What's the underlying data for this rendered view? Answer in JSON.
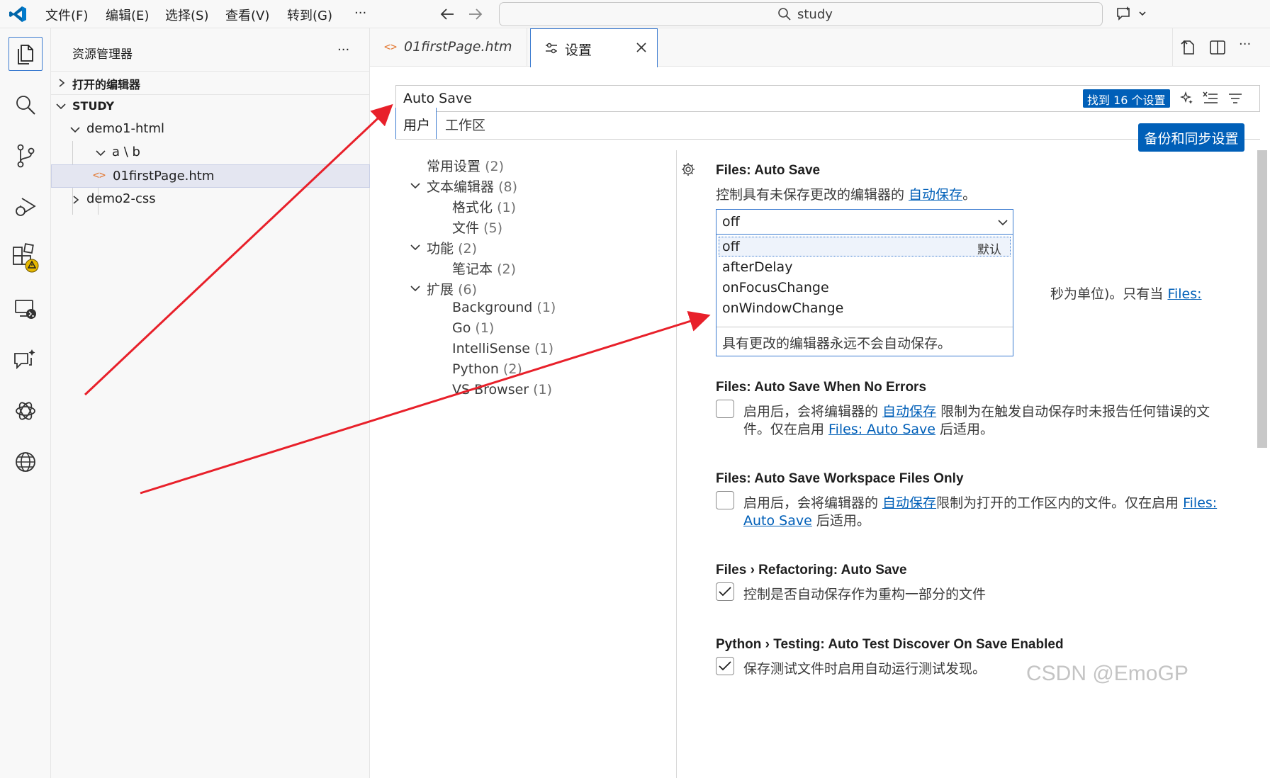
{
  "menu": [
    "文件(F)",
    "编辑(E)",
    "选择(S)",
    "查看(V)",
    "转到(G)",
    "···"
  ],
  "command_center": {
    "text": "study"
  },
  "explorer": {
    "title": "资源管理器",
    "more": "···",
    "open_editors": "打开的编辑器",
    "root": "STUDY",
    "items": [
      "demo1-html",
      "a \\ b",
      "01firstPage.htm",
      "demo2-css"
    ]
  },
  "tabs": [
    {
      "label": "01firstPage.htm"
    },
    {
      "label": "设置"
    }
  ],
  "settings": {
    "search_value": "Auto Save",
    "found_badge": "找到 16 个设置",
    "scope_tabs": [
      "用户",
      "工作区"
    ],
    "sync_button": "备份和同步设置",
    "toc": [
      {
        "label": "常用设置",
        "count": "(2)"
      },
      {
        "label": "文本编辑器",
        "count": "(8)"
      },
      {
        "label": "格式化",
        "count": "(1)"
      },
      {
        "label": "文件",
        "count": "(5)"
      },
      {
        "label": "功能",
        "count": "(2)"
      },
      {
        "label": "笔记本",
        "count": "(2)"
      },
      {
        "label": "扩展",
        "count": "(6)"
      },
      {
        "label": "Background",
        "count": "(1)"
      },
      {
        "label": "Go",
        "count": "(1)"
      },
      {
        "label": "IntelliSense",
        "count": "(1)"
      },
      {
        "label": "Python",
        "count": "(2)"
      },
      {
        "label": "VS Browser",
        "count": "(1)"
      }
    ],
    "autosave": {
      "title": "Files: Auto Save",
      "desc": "控制具有未保存更改的编辑器的 ",
      "desc_link": "自动保存",
      "desc_end": "。",
      "selected": "off",
      "options": [
        "off",
        "afterDelay",
        "onFocusChange",
        "onWindowChange"
      ],
      "default_tag": "默认",
      "option_desc": "具有更改的编辑器永远不会自动保存。",
      "hidden_text": "秒为单位)。只有当 ",
      "hidden_link": "Files:"
    },
    "no_errors": {
      "title": "Files: Auto Save When No Errors",
      "l1a": "启用后，会将编辑器的 ",
      "l1link": "自动保存",
      "l1b": " 限制为在触发自动保存时未报告任何错误的文",
      "l2a": "件。仅在启用 ",
      "l2link": "Files: Auto Save",
      "l2b": " 后适用。"
    },
    "workspace_only": {
      "title": "Files: Auto Save Workspace Files Only",
      "l1a": "启用后，会将编辑器的 ",
      "l1link": "自动保存",
      "l1b": "限制为打开的工作区内的文件。仅在启用 ",
      "l1link2": "Files:",
      "l2link": "Auto Save",
      "l2b": " 后适用。"
    },
    "refactoring": {
      "title": "Files › Refactoring: Auto Save",
      "desc": "控制是否自动保存作为重构一部分的文件"
    },
    "python_testing": {
      "title": "Python › Testing: Auto Test Discover On Save Enabled",
      "desc": "保存测试文件时启用自动运行测试发现。"
    }
  },
  "watermark": "CSDN @EmoGP",
  "colors": {
    "accent": "#005fb8",
    "arrow": "#e8202a",
    "warning": "#e6b800",
    "html_icon": "#e37933"
  }
}
